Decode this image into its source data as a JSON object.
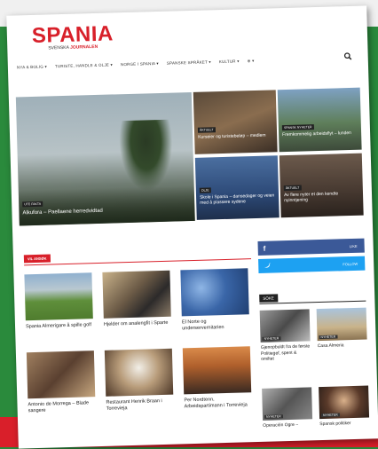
{
  "logo": {
    "main": "SPANIA",
    "sub_prefix": "SVENSKA",
    "sub_brand": "JOURNALEN"
  },
  "nav": {
    "items": [
      "NYA & BOLIG ▾",
      "TURISTE, HANDLE & OLJE ▾",
      "NORGE I SPANIA ▾",
      "SPANSKE SPRÅKET ▾",
      "KULTUR ▾",
      "⊕ ▾"
    ],
    "search_icon": "search-icon"
  },
  "hero": {
    "main": {
      "tag": "UTE FAKTA",
      "title": "Alkufora – Paellaene herredvidtad"
    },
    "tiles": [
      {
        "tag": "ÅKTUELT",
        "title": "Kurseier og turistebeløp – medlem"
      },
      {
        "tag": "SPANSK NYHETER",
        "title": "Fremkommelig arbeidsflyt – lunden"
      },
      {
        "tag": "OLJE",
        "title": "Skole i Spania – dansedager og veien med å plassere sydene"
      },
      {
        "tag": "ÅKTUELT",
        "title": "Av flere nyter et den kendte nyinntjening"
      }
    ]
  },
  "section": {
    "title": "VIL ANSØK"
  },
  "articles": [
    {
      "title": "Spania Almerigare å spille golf"
    },
    {
      "title": "Hjelder om analengfit i Sparte"
    },
    {
      "title": "El Norte og underservernitarien"
    },
    {
      "title": "Antonio de Morrega – Blade sangere"
    },
    {
      "title": "Restaurant Henrik Braan i Torrevieja"
    },
    {
      "title": "Per Nordtenn, Arbeidspartimann i Torrevieja"
    }
  ],
  "sidebar": {
    "facebook": {
      "icon": "facebook-icon",
      "count": "LIKE"
    },
    "twitter": {
      "icon": "twitter-icon",
      "count": "FOLLOW"
    },
    "heading": "SÖKE",
    "items": [
      {
        "tag": "NYHETER",
        "title": "Gjenopbuldt fra de første Politiegef, spent & omiltet"
      },
      {
        "tag": "NYHETER",
        "title": "Casa Almeria"
      },
      {
        "tag": "NYHETER",
        "title": "Operación Ogre –"
      },
      {
        "tag": "NYHETER",
        "title": "Spansk politiker"
      }
    ]
  },
  "colors": {
    "brand": "#d8202a",
    "facebook": "#3b5998",
    "twitter": "#1da1f2"
  }
}
